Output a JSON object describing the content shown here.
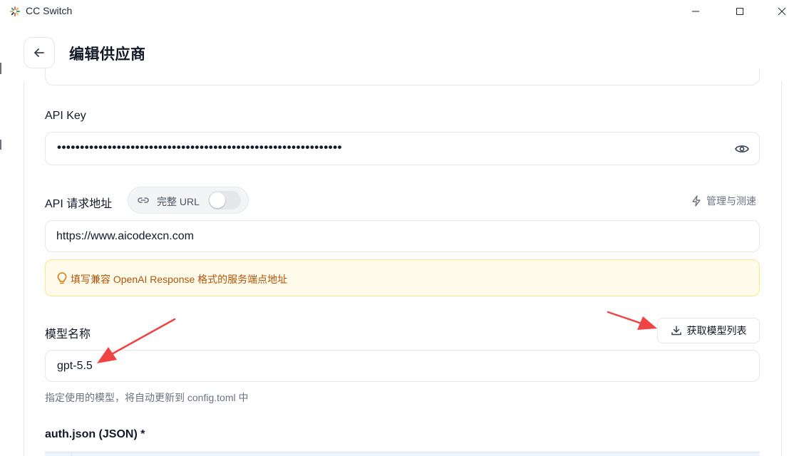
{
  "window": {
    "app_title": "CC Switch",
    "controls": [
      "minimize",
      "maximize",
      "close"
    ]
  },
  "header": {
    "title": "编辑供应商"
  },
  "form": {
    "api_key": {
      "label": "API Key",
      "value": "••••••••••••••••••••••••••••••••••••••••••••••••••••••••••••••"
    },
    "api_url": {
      "label": "API 请求地址",
      "full_url_label": "完整 URL",
      "full_url_enabled": false,
      "manage_label": "管理与测速",
      "value": "https://www.aicodexcn.com",
      "hint": "填写兼容 OpenAI Response 格式的服务端点地址"
    },
    "model": {
      "label": "模型名称",
      "fetch_button": "获取模型列表",
      "value": "gpt-5.5",
      "helper": "指定使用的模型，将自动更新到 config.toml 中"
    },
    "auth_json": {
      "label": "auth.json (JSON) *"
    }
  },
  "colors": {
    "hint_bg": "#fffbeb",
    "hint_text": "#b45309",
    "arrow": "#ef4444"
  }
}
